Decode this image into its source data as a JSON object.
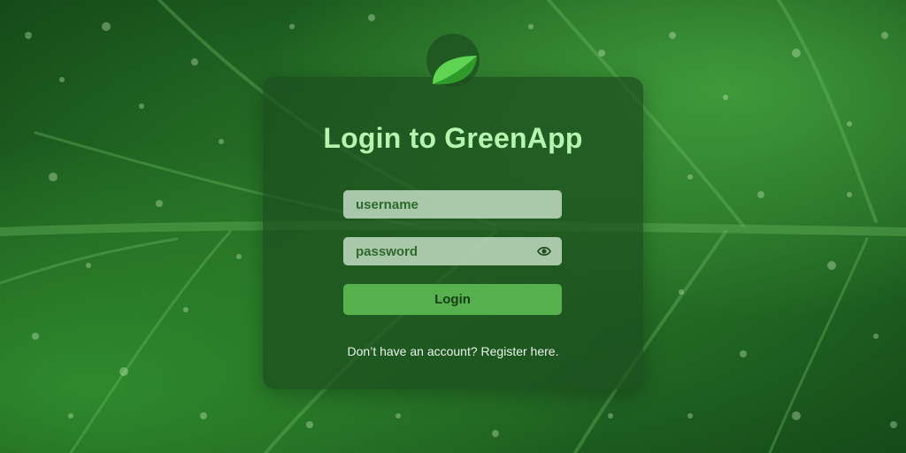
{
  "app": {
    "title": "Login to GreenApp"
  },
  "form": {
    "username_placeholder": "username",
    "password_placeholder": "password",
    "login_label": "Login"
  },
  "footer": {
    "prompt": "Don’t have an account?",
    "register_link": "Register here."
  },
  "icons": {
    "logo": "leaf-icon",
    "password_toggle": "eye-icon"
  },
  "colors": {
    "title": "#b6f5b0",
    "button": "#56b04e",
    "button_text": "#173f17",
    "field_text": "#2e6a2e",
    "leaf": "#5fd352"
  }
}
